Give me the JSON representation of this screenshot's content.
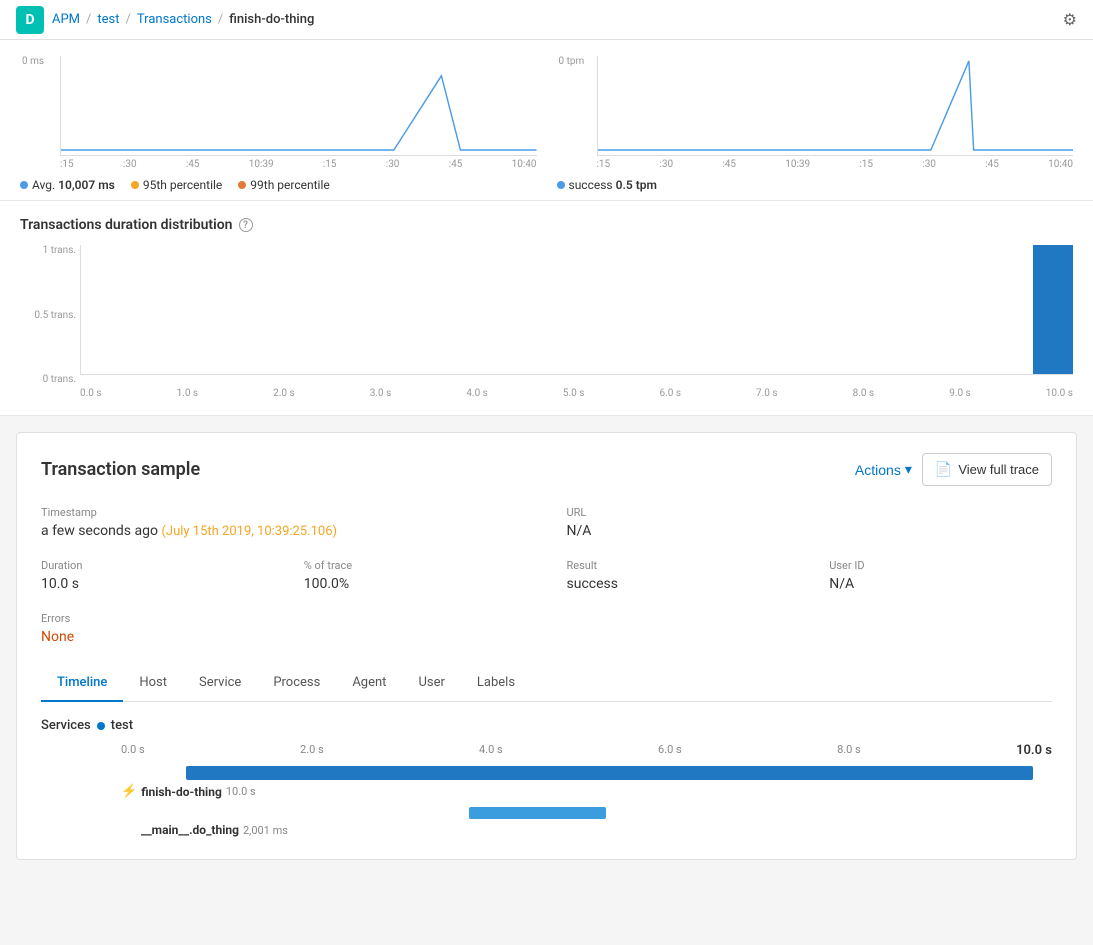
{
  "topbar": {
    "app_icon": "D",
    "breadcrumb": {
      "apm": "APM",
      "sep1": "/",
      "test": "test",
      "sep2": "/",
      "transactions": "Transactions",
      "sep3": "/",
      "current": "finish-do-thing"
    }
  },
  "left_chart": {
    "y_label": "0 ms",
    "x_labels": [
      ":15",
      ":30",
      ":45",
      "10:39",
      ":15",
      ":30",
      ":45",
      "10:40"
    ],
    "legend": [
      {
        "color": "#4c9be8",
        "label": "Avg.",
        "value": "10,007 ms"
      },
      {
        "color": "#f5a623",
        "label": "95th percentile",
        "value": ""
      },
      {
        "color": "#e07b39",
        "label": "99th percentile",
        "value": ""
      }
    ]
  },
  "right_chart": {
    "y_label": "0 tpm",
    "x_labels": [
      ":15",
      ":30",
      ":45",
      "10:39",
      ":15",
      ":30",
      ":45",
      "10:40"
    ],
    "legend": [
      {
        "color": "#4c9be8",
        "label": "success",
        "value": "0.5 tpm"
      }
    ]
  },
  "distribution": {
    "title": "Transactions duration distribution",
    "y_labels": [
      "1 trans.",
      "0.5 trans.",
      "0 trans."
    ],
    "x_labels": [
      "0.0 s",
      "1.0 s",
      "2.0 s",
      "3.0 s",
      "4.0 s",
      "5.0 s",
      "6.0 s",
      "7.0 s",
      "8.0 s",
      "9.0 s",
      "10.0 s"
    ]
  },
  "sample": {
    "title": "Transaction sample",
    "actions_label": "Actions",
    "view_trace_label": "View full trace",
    "timestamp_label": "Timestamp",
    "timestamp_ago": "a few seconds ago",
    "timestamp_detail": "(July 15th 2019, 10:39:25.106)",
    "url_label": "URL",
    "url_value": "N/A",
    "duration_label": "Duration",
    "duration_value": "10.0 s",
    "trace_label": "% of trace",
    "trace_value": "100.0%",
    "result_label": "Result",
    "result_value": "success",
    "userid_label": "User ID",
    "userid_value": "N/A",
    "errors_label": "Errors",
    "errors_value": "None"
  },
  "tabs": [
    "Timeline",
    "Host",
    "Service",
    "Process",
    "Agent",
    "User",
    "Labels"
  ],
  "active_tab": "Timeline",
  "timeline": {
    "services_label": "Services",
    "service_name": "test",
    "scale": [
      "0.0 s",
      "2.0 s",
      "4.0 s",
      "6.0 s",
      "8.0 s",
      "10.0 s"
    ],
    "spans": [
      {
        "name": "finish-do-thing",
        "duration": "10.0 s",
        "bar_left_pct": 7,
        "bar_width_pct": 91,
        "indent": 0
      },
      {
        "name": "__main__.do_thing",
        "duration": "2,001 ms",
        "bar_left_pct": 36,
        "bar_width_pct": 15,
        "indent": 1
      }
    ]
  }
}
